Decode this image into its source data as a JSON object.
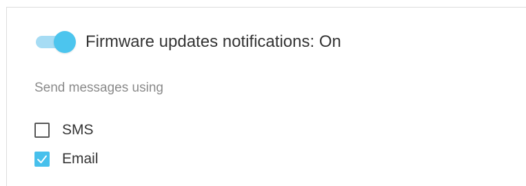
{
  "notifications": {
    "toggle_label": "Firmware updates notifications: On",
    "toggle_state": "on"
  },
  "delivery": {
    "section_label": "Send messages using",
    "options": [
      {
        "label": "SMS",
        "checked": false
      },
      {
        "label": "Email",
        "checked": true
      }
    ]
  },
  "colors": {
    "accent": "#47c0ec",
    "toggle_track": "#a6dcf4",
    "text": "#333333",
    "muted_text": "#8a8a8a"
  }
}
